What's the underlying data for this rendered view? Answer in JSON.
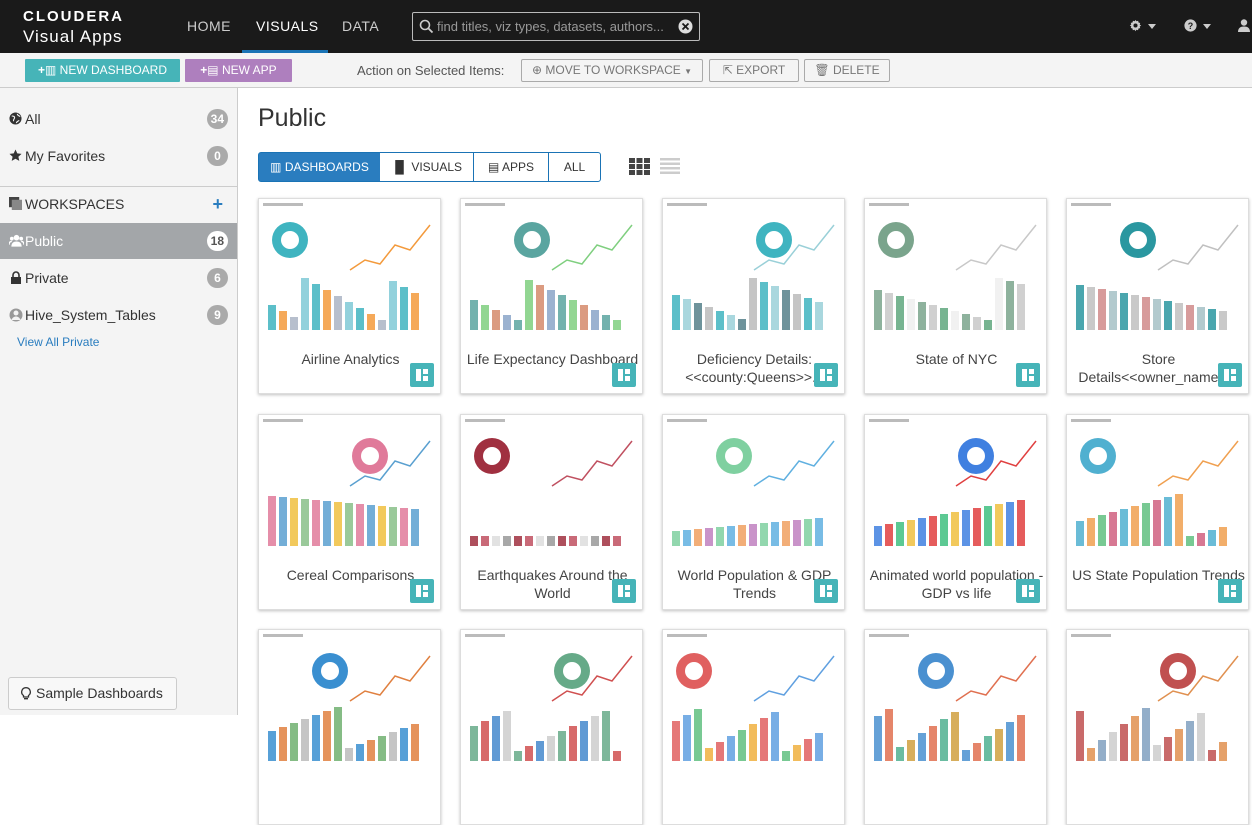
{
  "app": {
    "logo_line1": "CLOUDERA",
    "logo_line2": "Visual Apps"
  },
  "nav": {
    "home": "HOME",
    "visuals": "VISUALS",
    "data": "DATA"
  },
  "search": {
    "placeholder": "find titles, viz types, datasets, authors..."
  },
  "toolbar": {
    "new_dashboard": "NEW DASHBOARD",
    "new_app": "NEW APP",
    "action_label": "Action on Selected Items:",
    "move_to_workspace": "MOVE TO WORKSPACE",
    "export": "EXPORT",
    "delete": "DELETE"
  },
  "sidebar": {
    "all": {
      "label": "All",
      "count": "34"
    },
    "favorites": {
      "label": "My Favorites",
      "count": "0"
    },
    "workspaces_label": "WORKSPACES",
    "public": {
      "label": "Public",
      "count": "18"
    },
    "private": {
      "label": "Private",
      "count": "6"
    },
    "hive": {
      "label": "Hive_System_Tables",
      "count": "9"
    },
    "view_all_private": "View All Private",
    "sample_dashboards": "Sample Dashboards"
  },
  "main": {
    "title": "Public",
    "tabs": {
      "dashboards": "DASHBOARDS",
      "visuals": "VISUALS",
      "apps": "APPS",
      "all": "ALL"
    }
  },
  "cards": [
    {
      "title": "Airline Analytics"
    },
    {
      "title": "Life Expectancy Dashboard"
    },
    {
      "title": "Deficiency Details: <<county:Queens>>..."
    },
    {
      "title": "State of NYC"
    },
    {
      "title": "Store Details<<owner_name:>>"
    },
    {
      "title": "Cereal Comparisons"
    },
    {
      "title": "Earthquakes Around the World"
    },
    {
      "title": "World Population & GDP Trends"
    },
    {
      "title": "Animated world population - GDP vs life"
    },
    {
      "title": "US State Population Trends"
    },
    {
      "title": ""
    },
    {
      "title": ""
    },
    {
      "title": ""
    },
    {
      "title": ""
    },
    {
      "title": ""
    }
  ],
  "colors": {
    "accent": "#2a7dbf",
    "teal": "#46b4b8",
    "purple": "#ae7fbe",
    "topbar": "#1a1a1a"
  }
}
